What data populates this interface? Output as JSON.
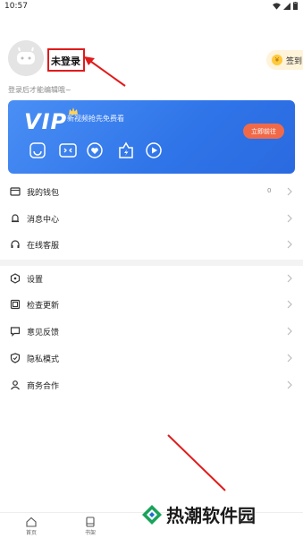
{
  "status_bar": {
    "time": "10:57"
  },
  "profile": {
    "username": "未登录",
    "hint": "登录后才能编辑哦~",
    "signin_label": "签到"
  },
  "vip": {
    "title": "VIP",
    "subtitle": "新视频抢先免费看",
    "button_label": "立即前往",
    "icons": [
      "game-icon",
      "smile-icon",
      "heart-icon",
      "lightning-badge-icon",
      "play-icon"
    ]
  },
  "menu_group_1": [
    {
      "label": "我的钱包",
      "value": "0",
      "icon": "wallet-icon"
    },
    {
      "label": "消息中心",
      "value": "",
      "icon": "bell-icon"
    },
    {
      "label": "在线客服",
      "value": "",
      "icon": "headset-icon"
    }
  ],
  "menu_group_2": [
    {
      "label": "设置",
      "icon": "settings-icon"
    },
    {
      "label": "检查更新",
      "icon": "update-icon"
    },
    {
      "label": "意见反馈",
      "icon": "feedback-icon"
    },
    {
      "label": "隐私模式",
      "icon": "shield-icon"
    },
    {
      "label": "商务合作",
      "icon": "person-icon"
    }
  ],
  "bottom_nav": {
    "home_label": "首页",
    "shelf_label": "书架"
  },
  "watermark": {
    "text": "热潮软件园"
  },
  "colors": {
    "vip_gradient_start": "#4a8ff5",
    "vip_gradient_end": "#2a6ae0",
    "vip_button": "#f06a4a",
    "annotation_red": "#e01b1b",
    "signin_bg": "#fff3d9"
  }
}
